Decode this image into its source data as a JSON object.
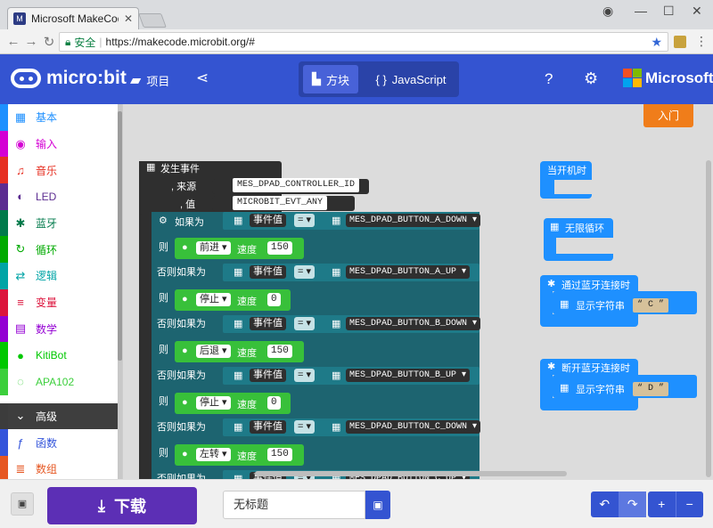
{
  "browser": {
    "tab_title": "Microsoft MakeCode fo",
    "secure_label": "安全",
    "url": "https://makecode.microbit.org/#"
  },
  "header": {
    "logo_text": "micro:bit",
    "projects_label": "项目",
    "mode_blocks": "方块",
    "mode_js": "JavaScript",
    "brand": "Microsoft",
    "accent": "#3454d1"
  },
  "intro_label": "入门",
  "toolbox": [
    {
      "label": "基本",
      "color": "#1e90ff",
      "icon": "grid-icon",
      "glyph": "▦"
    },
    {
      "label": "输入",
      "color": "#d400d4",
      "icon": "target-icon",
      "glyph": "◉"
    },
    {
      "label": "音乐",
      "color": "#e63022",
      "icon": "headphones-icon",
      "glyph": "♫"
    },
    {
      "label": "LED",
      "color": "#5c2d91",
      "icon": "toggle-icon",
      "glyph": "◐"
    },
    {
      "label": "蓝牙",
      "color": "#007a4b",
      "icon": "bluetooth-icon",
      "glyph": "✱"
    },
    {
      "label": "循环",
      "color": "#00aa00",
      "icon": "loop-icon",
      "glyph": "↻"
    },
    {
      "label": "逻辑",
      "color": "#00a4a6",
      "icon": "shuffle-icon",
      "glyph": "⇄"
    },
    {
      "label": "变量",
      "color": "#dc143c",
      "icon": "list-icon",
      "glyph": "≡"
    },
    {
      "label": "数学",
      "color": "#9400d3",
      "icon": "calculator-icon",
      "glyph": "▤"
    },
    {
      "label": "KitiBot",
      "color": "#00c800",
      "icon": "car-icon",
      "glyph": "●"
    },
    {
      "label": "APA102",
      "color": "#3ccf3c",
      "icon": "ring-icon",
      "glyph": "◌"
    }
  ],
  "advanced": [
    {
      "label": "高级",
      "color": "#3c3c3c",
      "glyph": "⌄"
    },
    {
      "label": "函数",
      "color": "#3455db",
      "glyph": "ƒ"
    },
    {
      "label": "数组",
      "color": "#e65722",
      "glyph": "≣"
    }
  ],
  "blocks": {
    "event_header": "发生事件",
    "source_label": ", 来源",
    "value_label": ", 值",
    "source_value": "MES_DPAD_CONTROLLER_ID",
    "value_value": "MICROBIT_EVT_ANY",
    "if_label": "如果为",
    "then_label": "则",
    "elseif_label": "否则如果为",
    "event_value_label": "事件值",
    "equals_label": "=",
    "speed_label": "速度",
    "branches": [
      {
        "constant": "MES_DPAD_BUTTON_A_DOWN",
        "action": "前进",
        "speed": "150"
      },
      {
        "constant": "MES_DPAD_BUTTON_A_UP",
        "action": "停止",
        "speed": "0"
      },
      {
        "constant": "MES_DPAD_BUTTON_B_DOWN",
        "action": "后退",
        "speed": "150"
      },
      {
        "constant": "MES_DPAD_BUTTON_B_UP",
        "action": "停止",
        "speed": "0"
      },
      {
        "constant": "MES_DPAD_BUTTON_C_DOWN",
        "action": "左转",
        "speed": "150"
      },
      {
        "constant": "MES_DPAD_BUTTON_C_UP",
        "action": "",
        "speed": ""
      }
    ],
    "on_start": "当开机时",
    "forever": "无限循环",
    "bt_connected": "通过蓝牙连接时",
    "bt_disconnected": "断开蓝牙连接时",
    "show_string": "显示字符串",
    "string_c": "C",
    "string_d": "D"
  },
  "bottom": {
    "download_label": "下载",
    "project_name": "无标题",
    "undo": "↶",
    "redo": "↷",
    "zoom_in": "+",
    "zoom_out": "−"
  }
}
